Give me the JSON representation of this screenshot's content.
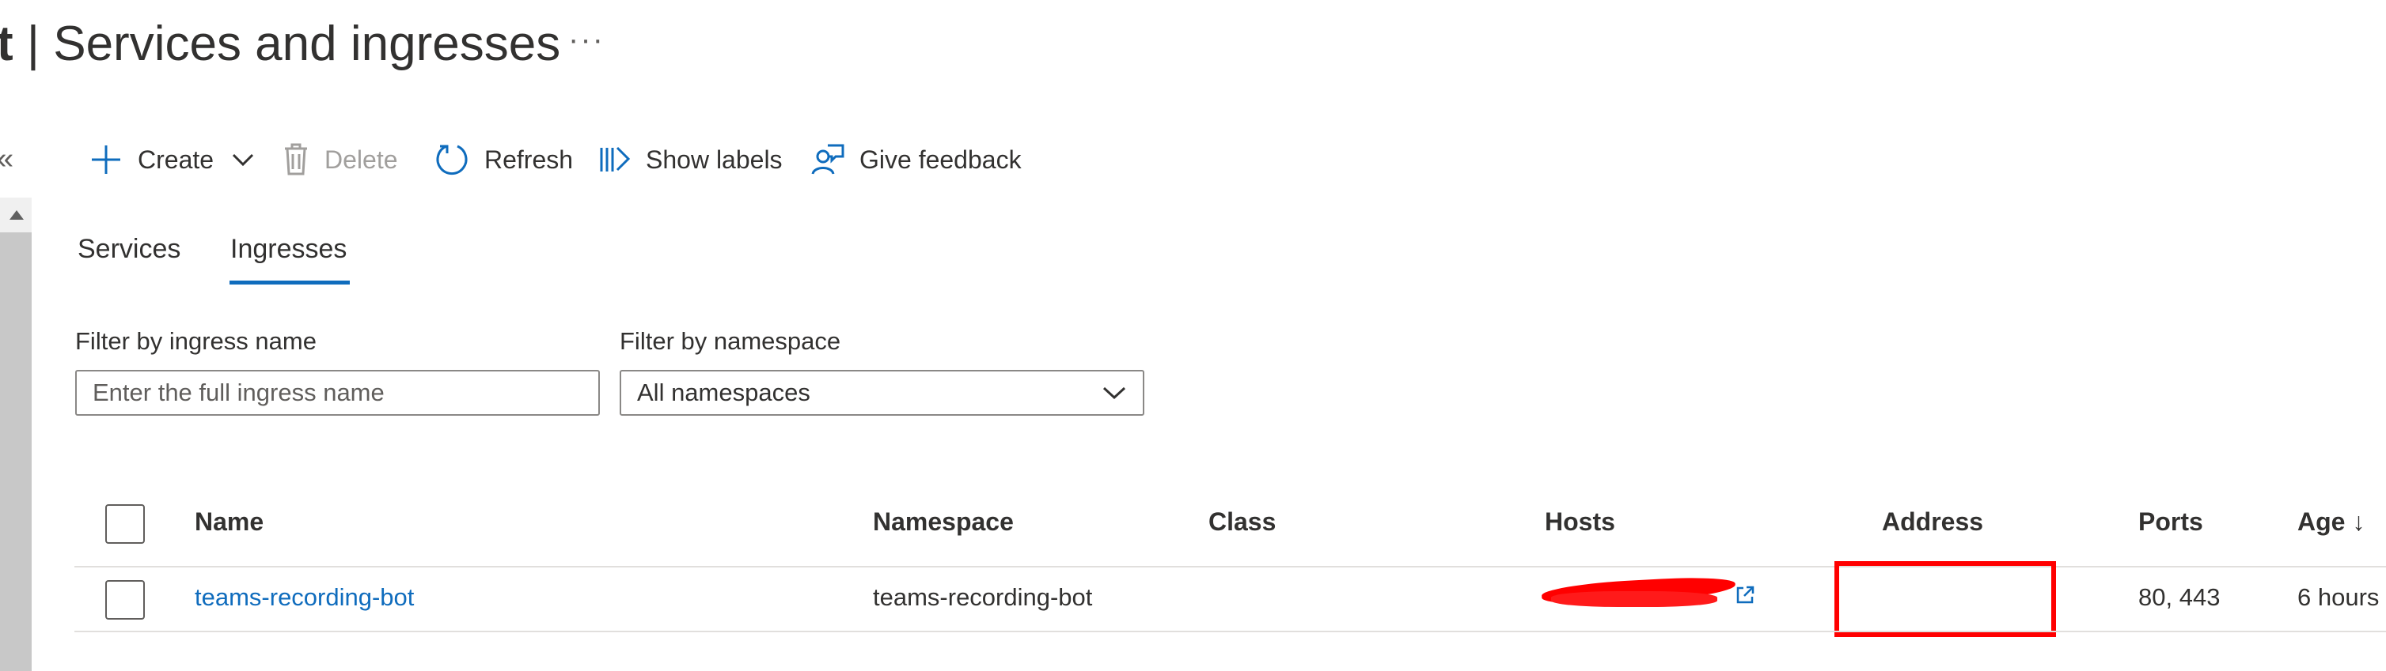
{
  "header": {
    "title_strong": "t",
    "title_rest": " | Services and ingresses",
    "more_label": "···",
    "collapse_label": "«"
  },
  "toolbar": {
    "create_label": "Create",
    "delete_label": "Delete",
    "refresh_label": "Refresh",
    "show_labels_label": "Show labels",
    "feedback_label": "Give feedback",
    "accent_color": "#0f6cbd"
  },
  "tabs": [
    {
      "label": "Services",
      "selected": false
    },
    {
      "label": "Ingresses",
      "selected": true
    }
  ],
  "filters": {
    "ingress_name": {
      "label": "Filter by ingress name",
      "placeholder": "Enter the full ingress name"
    },
    "namespace": {
      "label": "Filter by namespace",
      "value": "All namespaces"
    }
  },
  "table": {
    "columns": [
      "Name",
      "Namespace",
      "Class",
      "Hosts",
      "Address",
      "Ports",
      "Age ↓"
    ],
    "rows": [
      {
        "name": "teams-recording-bot",
        "namespace": "teams-recording-bot",
        "class": "",
        "hosts": "",
        "address": "",
        "ports": "80, 443",
        "age": "6 hours"
      }
    ]
  },
  "annotations": {
    "highlight_color": "#ff0000"
  }
}
